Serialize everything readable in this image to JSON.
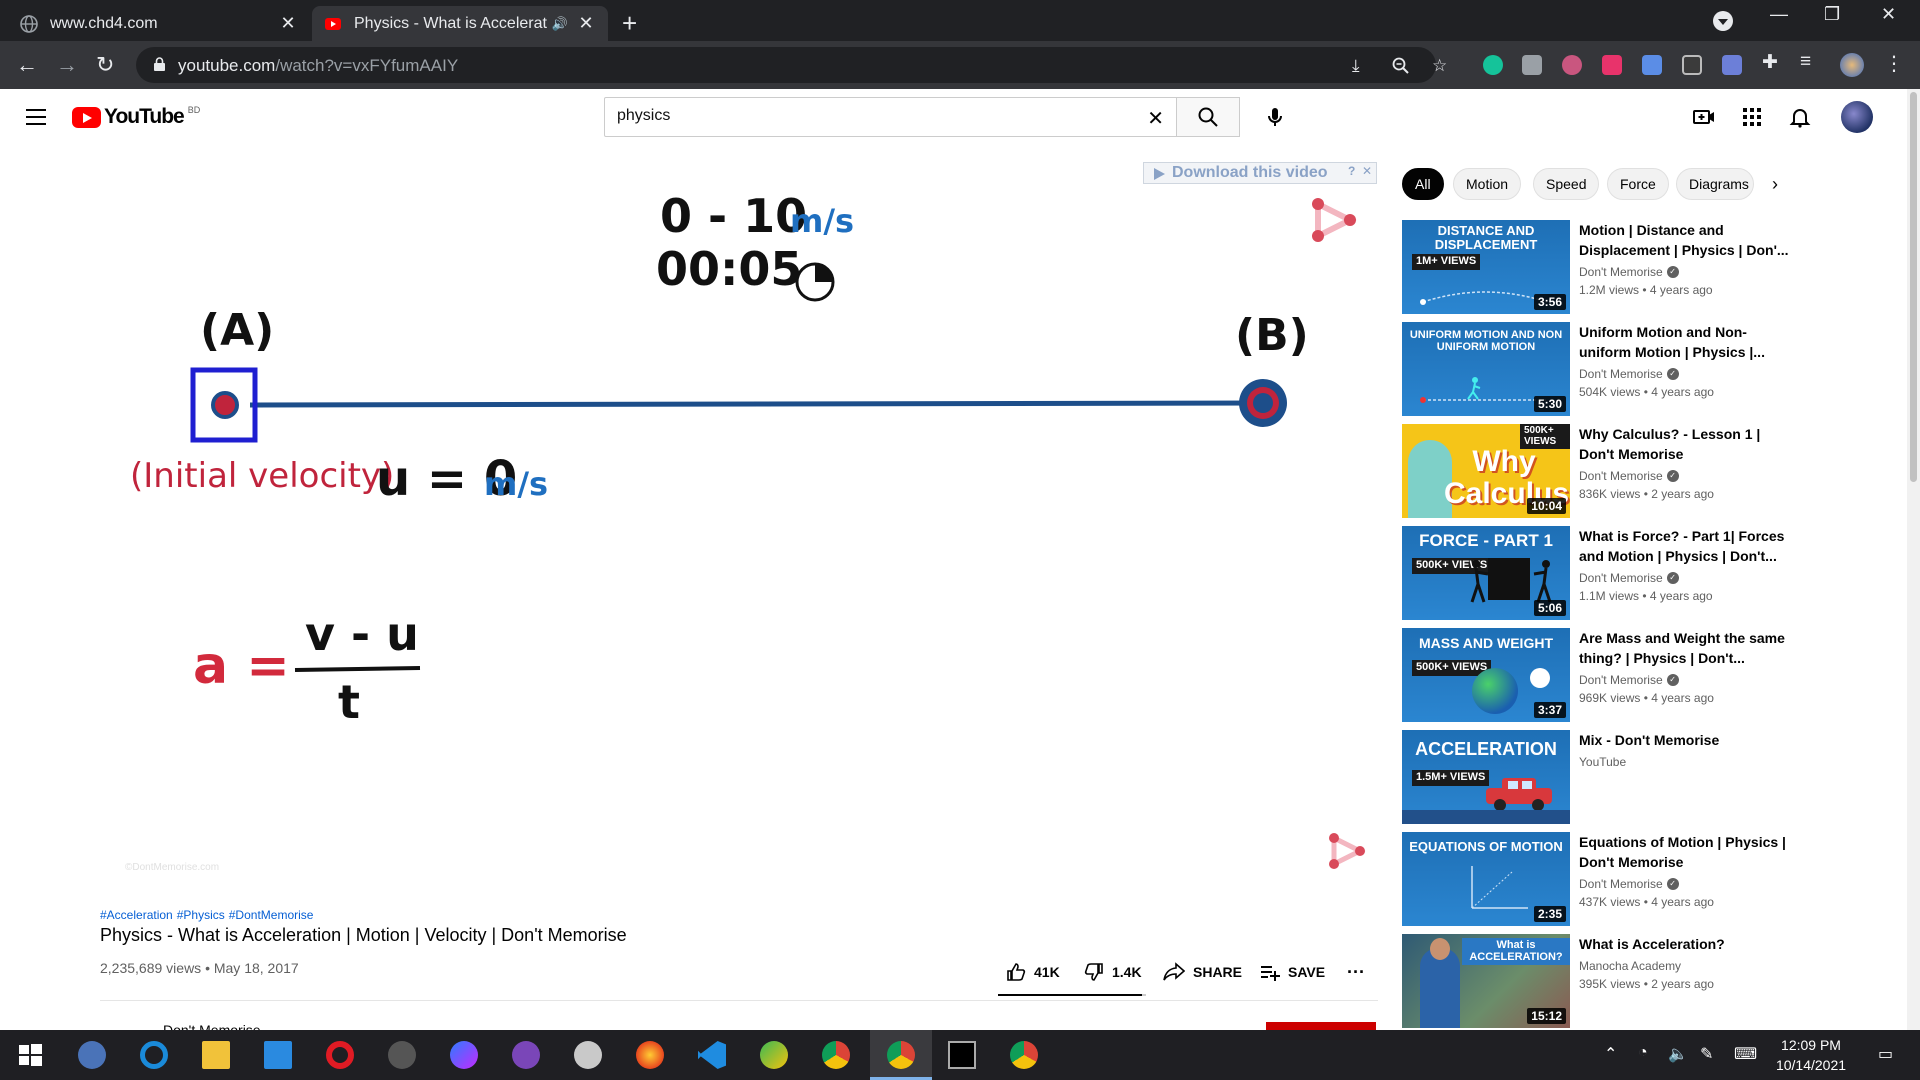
{
  "browser": {
    "tabs": [
      {
        "label": "www.chd4.com",
        "close": "✕"
      },
      {
        "label": "Physics - What is Acceleratio",
        "close": "✕"
      }
    ],
    "new_tab": "+",
    "url_main": "youtube.com",
    "url_path": "/watch?v=vxFYfumAAIY"
  },
  "youtube": {
    "logo_text": "YouTube",
    "country_code": "BD",
    "search_value": "physics",
    "clear": "✕"
  },
  "video": {
    "download_label": "Download this video",
    "range_text": "0 - 10",
    "range_unit": "m/s",
    "timer": "00:05",
    "label_a": "(A)",
    "label_b": "(B)",
    "initial_velocity_label": "(Initial velocity)",
    "u_eq": "u = 0",
    "u_unit": "m/s",
    "formula_lhs": "a =",
    "formula_num": "v - u",
    "formula_den": "t",
    "watermark": "©DontMemorise.com"
  },
  "meta": {
    "hashtags": [
      "#Acceleration",
      "#Physics",
      "#DontMemorise"
    ],
    "title": "Physics - What is Acceleration | Motion | Velocity | Don't Memorise",
    "views_date": "2,235,689 views • May 18, 2017",
    "likes": "41K",
    "dislikes": "1.4K",
    "share": "SHARE",
    "save": "SAVE",
    "more": "···",
    "channel_peek": "Don't Memorise"
  },
  "chips": [
    "All",
    "Motion",
    "Speed",
    "Force",
    "Diagrams"
  ],
  "chip_next": "›",
  "recommendations": [
    {
      "title": "Motion | Distance and Displacement | Physics | Don'...",
      "channel": "Don't Memorise",
      "verified": true,
      "meta": "1.2M views • 4 years ago",
      "duration": "3:56",
      "thumb_text": "DISTANCE AND DISPLACEMENT",
      "thumb_views": "1M+ VIEWS",
      "thumb_color": "#1e6fb5"
    },
    {
      "title": "Uniform Motion and Non-uniform Motion | Physics |...",
      "channel": "Don't Memorise",
      "verified": true,
      "meta": "504K views • 4 years ago",
      "duration": "5:30",
      "thumb_text": "UNIFORM MOTION AND NON UNIFORM MOTION",
      "thumb_views": "",
      "thumb_color": "#1e6fb5"
    },
    {
      "title": "Why Calculus? - Lesson 1 | Don't Memorise",
      "channel": "Don't Memorise",
      "verified": true,
      "meta": "836K views • 2 years ago",
      "duration": "10:04",
      "thumb_text": "Why Calculus?",
      "thumb_views": "500K+ VIEWS",
      "thumb_color": "#f5c518"
    },
    {
      "title": "What is Force? - Part 1| Forces and Motion | Physics | Don't...",
      "channel": "Don't Memorise",
      "verified": true,
      "meta": "1.1M views • 4 years ago",
      "duration": "5:06",
      "thumb_text": "FORCE - PART 1",
      "thumb_views": "500K+ VIEWS",
      "thumb_color": "#1e6fb5"
    },
    {
      "title": "Are Mass and Weight the same thing? | Physics | Don't...",
      "channel": "Don't Memorise",
      "verified": true,
      "meta": "969K views • 4 years ago",
      "duration": "3:37",
      "thumb_text": "MASS AND WEIGHT",
      "thumb_views": "500K+ VIEWS",
      "thumb_color": "#1e6fb5"
    },
    {
      "title": "Mix - Don't Memorise",
      "channel": "YouTube",
      "verified": false,
      "meta": "",
      "duration": "",
      "thumb_text": "ACCELERATION",
      "thumb_views": "1.5M+ VIEWS",
      "thumb_color": "#1e6fb5"
    },
    {
      "title": "Equations of Motion | Physics | Don't Memorise",
      "channel": "Don't Memorise",
      "verified": true,
      "meta": "437K views • 4 years ago",
      "duration": "2:35",
      "thumb_text": "EQUATIONS OF MOTION",
      "thumb_views": "",
      "thumb_color": "#1e6fb5"
    },
    {
      "title": "What is Acceleration?",
      "channel": "Manocha Academy",
      "verified": false,
      "meta": "395K views • 2 years ago",
      "duration": "15:12",
      "thumb_text": "What is ACCELERATION?",
      "thumb_views": "",
      "thumb_color": "#3a6a8a"
    }
  ],
  "taskbar": {
    "time": "12:09 PM",
    "date": "10/14/2021"
  }
}
